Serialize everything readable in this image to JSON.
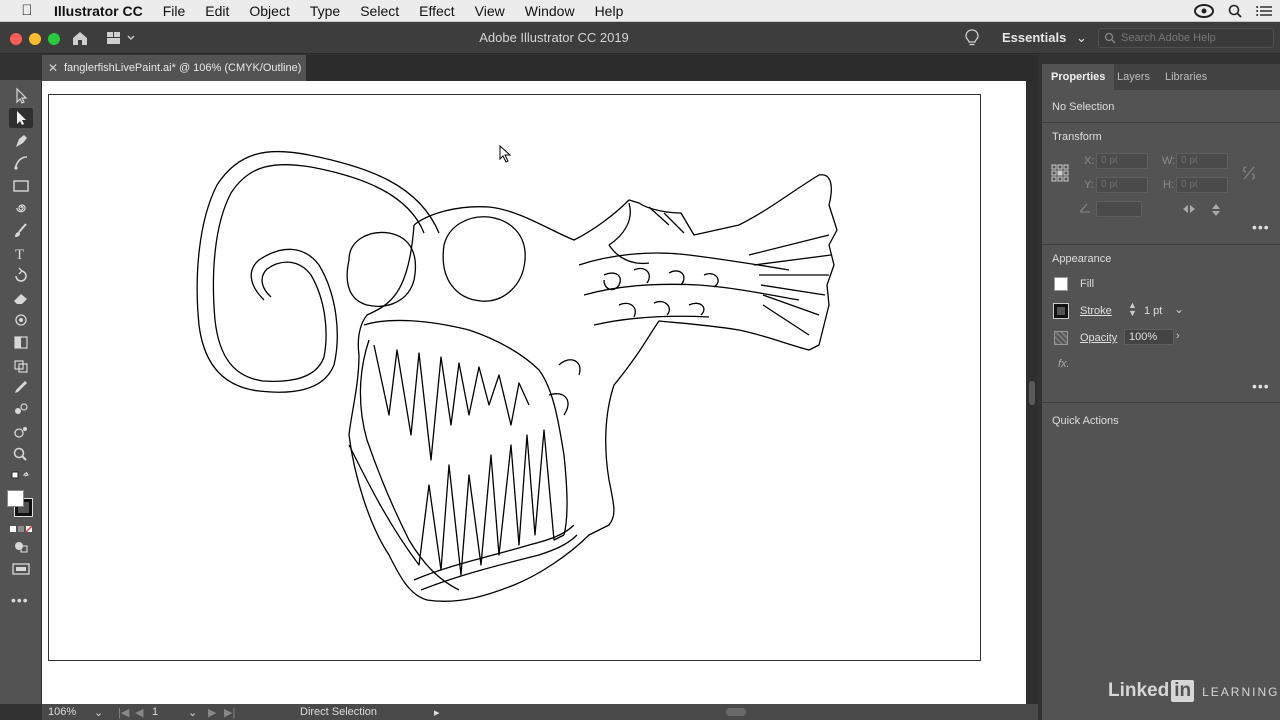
{
  "menubar": {
    "app_name": "Illustrator CC",
    "items": [
      "File",
      "Edit",
      "Object",
      "Type",
      "Select",
      "Effect",
      "View",
      "Window",
      "Help"
    ]
  },
  "window": {
    "title": "Adobe Illustrator CC 2019",
    "workspace": "Essentials",
    "search_placeholder": "Search Adobe Help"
  },
  "document": {
    "tab_label": "fanglerfishLivePaint.ai* @ 106% (CMYK/Outline)"
  },
  "panel": {
    "tabs": [
      "Properties",
      "Layers",
      "Libraries"
    ],
    "active_tab": "Properties",
    "selection": "No Selection",
    "transform": {
      "heading": "Transform",
      "x_label": "X:",
      "y_label": "Y:",
      "w_label": "W:",
      "h_label": "H:",
      "placeholder": "0 pt"
    },
    "appearance": {
      "heading": "Appearance",
      "fill_label": "Fill",
      "stroke_label": "Stroke",
      "stroke_value": "1 pt",
      "opacity_label": "Opacity",
      "opacity_value": "100%",
      "fx_label": "fx."
    },
    "quick_actions": "Quick Actions"
  },
  "statusbar": {
    "zoom": "106%",
    "artboard": "1",
    "tool": "Direct Selection"
  },
  "watermark": {
    "brand": "Linked",
    "brand_in": "in",
    "learning": "LEARNING"
  },
  "colors": {
    "panel_bg": "#535353",
    "canvas_bg": "#ffffff",
    "dark_chrome": "#323232"
  }
}
